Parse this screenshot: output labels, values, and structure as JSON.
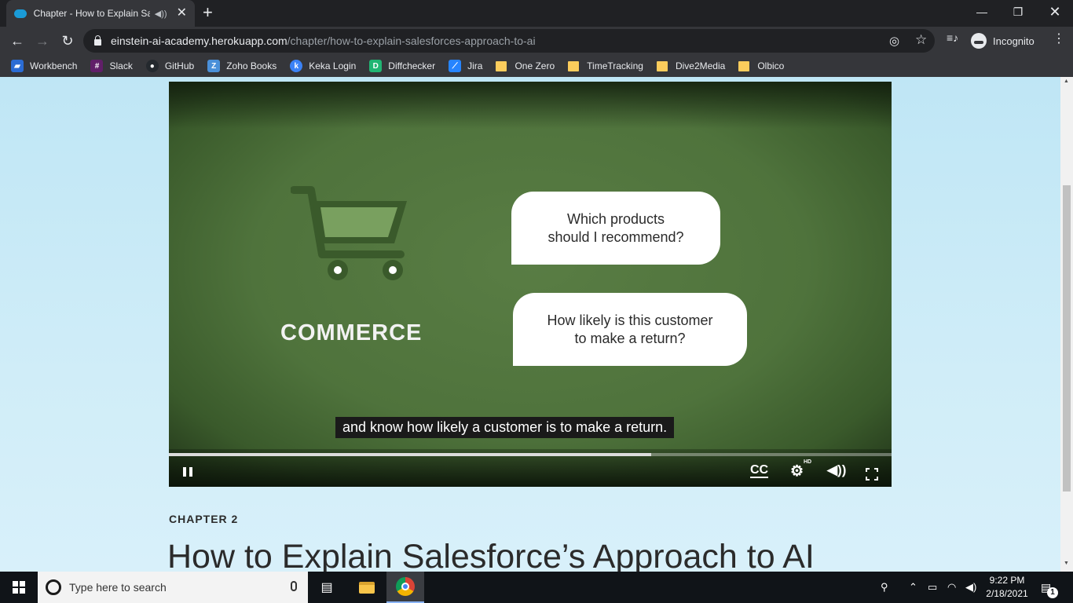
{
  "browser": {
    "tab_title": "Chapter - How to Explain Sal",
    "tab_audio_icon": "speaker-icon",
    "new_tab_label": "+",
    "url_host": "einstein-ai-academy.herokuapp.com",
    "url_path": "/chapter/how-to-explain-salesforces-approach-to-ai",
    "profile_label": "Incognito",
    "bookmarks": [
      {
        "label": "Workbench",
        "icon": "workbench-icon",
        "color": "#2b6cd4"
      },
      {
        "label": "Slack",
        "icon": "slack-icon",
        "color": "#611f69"
      },
      {
        "label": "GitHub",
        "icon": "github-icon",
        "color": "#24292e"
      },
      {
        "label": "Zoho Books",
        "icon": "zoho-books-icon",
        "color": "#4a90d9"
      },
      {
        "label": "Keka Login",
        "icon": "keka-icon",
        "color": "#3b82f6"
      },
      {
        "label": "Diffchecker",
        "icon": "diffchecker-icon",
        "color": "#21b573"
      },
      {
        "label": "Jira",
        "icon": "jira-icon",
        "color": "#2684ff"
      },
      {
        "label": "One Zero",
        "icon": "folder-icon",
        "color": "#fbcc5c"
      },
      {
        "label": "TimeTracking",
        "icon": "folder-icon",
        "color": "#fbcc5c"
      },
      {
        "label": "Dive2Media",
        "icon": "folder-icon",
        "color": "#fbcc5c"
      },
      {
        "label": "Olbico",
        "icon": "folder-icon",
        "color": "#fbcc5c"
      }
    ]
  },
  "video": {
    "category_label": "COMMERCE",
    "bubble1_line1": "Which products",
    "bubble1_line2": "should I recommend?",
    "bubble2_line1": "How likely is this customer",
    "bubble2_line2": "to make a return?",
    "caption": "and know how likely a customer is to make a return.",
    "cc_label": "CC",
    "hd_badge": "HD",
    "progress_fraction": 0.667,
    "accent_green": "#4f733c"
  },
  "page": {
    "chapter_label": "CHAPTER 2",
    "heading": "How to Explain Salesforce’s Approach to AI"
  },
  "taskbar": {
    "search_placeholder": "Type here to search",
    "time": "9:22 PM",
    "date": "2/18/2021",
    "notification_count": "1"
  }
}
